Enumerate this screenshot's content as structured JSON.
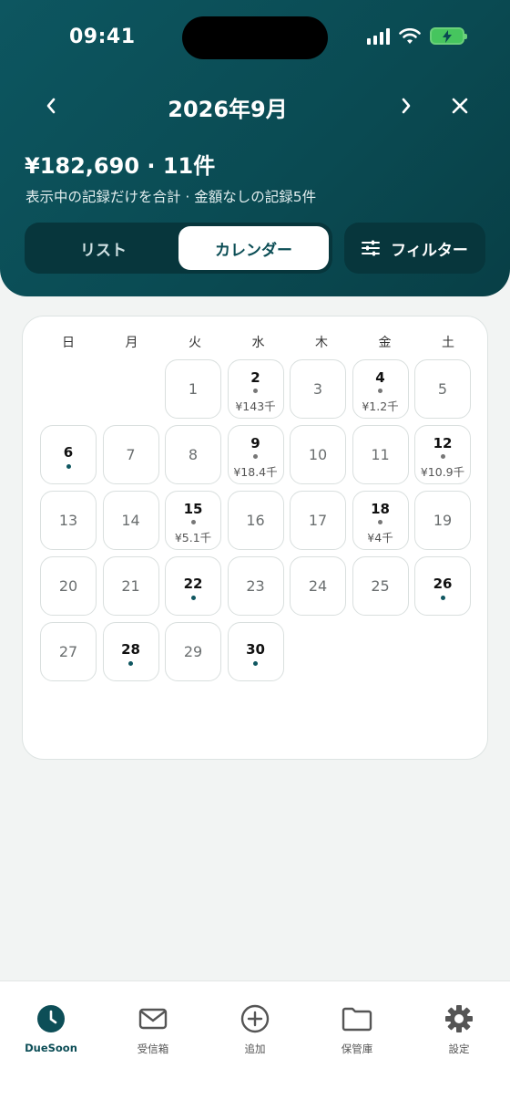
{
  "status": {
    "time": "09:41"
  },
  "header": {
    "month_title": "2026年9月",
    "summary": "¥182,690 · 11件",
    "summary_sub": "表示中の記録だけを合計 · 金額なしの記録5件"
  },
  "view_toggle": {
    "list_label": "リスト",
    "calendar_label": "カレンダー",
    "selected": "カレンダー"
  },
  "filter": {
    "label": "フィルター",
    "icon": "sliders-icon"
  },
  "calendar": {
    "weekdays": [
      "日",
      "月",
      "火",
      "水",
      "木",
      "金",
      "土"
    ],
    "leading_blanks": 2,
    "days": [
      {
        "d": "1"
      },
      {
        "d": "2",
        "amt": "¥143千"
      },
      {
        "d": "3"
      },
      {
        "d": "4",
        "amt": "¥1.2千"
      },
      {
        "d": "5"
      },
      {
        "d": "6",
        "dot": true
      },
      {
        "d": "7"
      },
      {
        "d": "8"
      },
      {
        "d": "9",
        "amt": "¥18.4千"
      },
      {
        "d": "10"
      },
      {
        "d": "11"
      },
      {
        "d": "12",
        "amt": "¥10.9千"
      },
      {
        "d": "13"
      },
      {
        "d": "14"
      },
      {
        "d": "15",
        "amt": "¥5.1千"
      },
      {
        "d": "16"
      },
      {
        "d": "17"
      },
      {
        "d": "18",
        "amt": "¥4千"
      },
      {
        "d": "19"
      },
      {
        "d": "20"
      },
      {
        "d": "21"
      },
      {
        "d": "22",
        "dot": true
      },
      {
        "d": "23"
      },
      {
        "d": "24"
      },
      {
        "d": "25"
      },
      {
        "d": "26",
        "dot": true
      },
      {
        "d": "27"
      },
      {
        "d": "28",
        "dot": true
      },
      {
        "d": "29"
      },
      {
        "d": "30",
        "dot": true
      }
    ]
  },
  "tabs": [
    {
      "label": "DueSoon",
      "icon": "clock-icon",
      "active": true
    },
    {
      "label": "受信箱",
      "icon": "mail-icon"
    },
    {
      "label": "追加",
      "icon": "plus-circle-icon"
    },
    {
      "label": "保管庫",
      "icon": "folder-icon"
    },
    {
      "label": "設定",
      "icon": "gear-icon"
    }
  ],
  "colors": {
    "header": "#0a4a52",
    "accent": "#0d4e57",
    "background": "#f2f4f3"
  }
}
